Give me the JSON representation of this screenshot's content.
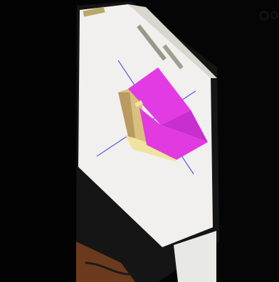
{
  "photo": {
    "subject": "monitor-showing-cad-viewport",
    "colors": {
      "magenta_face": "#e23be3",
      "magenta_shade": "#c82ed0",
      "tan_face": "#d9bf80",
      "tan_shade": "#b99a5f",
      "cream_face": "#efe3a0",
      "axis": "#5a5adf",
      "screen": "#f1f0ee",
      "background": "#050505"
    }
  },
  "watermark": {
    "icon": "circle-logo-icon",
    "partial_text": "O"
  }
}
